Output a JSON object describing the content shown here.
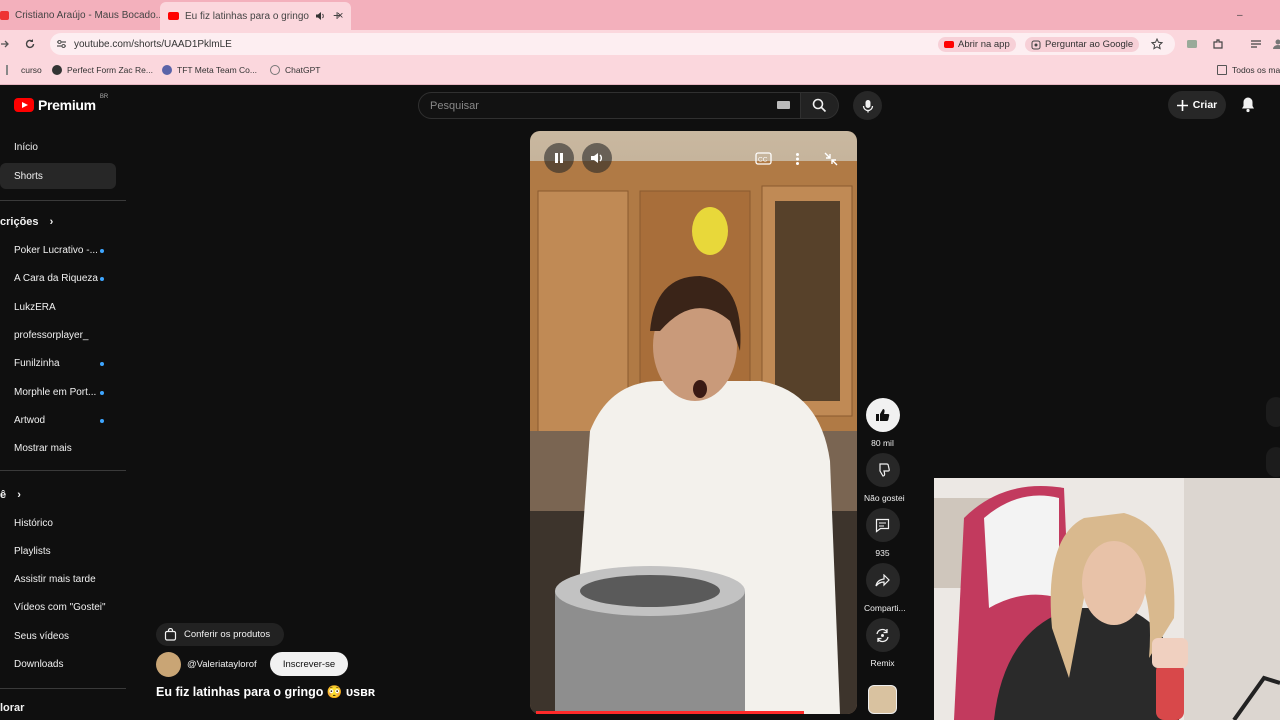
{
  "browser": {
    "tabs": [
      {
        "title": "Cristiano Araújo - Maus Bocado...",
        "close": "×"
      },
      {
        "title": "Eu fiz latinhas para o gringo",
        "close": "×"
      }
    ],
    "new_tab": "+",
    "url": "youtube.com/shorts/UAAD1PklmLE",
    "open_app": "Abrir na app",
    "ask_google": "Perguntar ao Google",
    "bookmarks": [
      {
        "label": "curso"
      },
      {
        "label": "Perfect Form Zac Re..."
      },
      {
        "label": "TFT Meta Team Co..."
      },
      {
        "label": "ChatGPT"
      }
    ],
    "all_bookmarks": "Todos os ma",
    "window_minimize": "–"
  },
  "yt": {
    "logo_text": "Premium",
    "logo_sup": "BR",
    "search_placeholder": "Pesquisar",
    "create_label": "Criar",
    "sidebar": {
      "top": [
        "Início",
        "Shorts"
      ],
      "subs_title": "crições",
      "subs": [
        {
          "label": "Poker Lucrativo -...",
          "dot": true
        },
        {
          "label": "A Cara da Riqueza",
          "dot": true
        },
        {
          "label": "LukzERA",
          "dot": false
        },
        {
          "label": "professorplayer_",
          "dot": false
        },
        {
          "label": "Funilzinha",
          "dot": true
        },
        {
          "label": "Morphle em Port...",
          "dot": true
        },
        {
          "label": "Artwod",
          "dot": true
        },
        {
          "label": "Mostrar mais",
          "dot": false
        }
      ],
      "you_title": "ê",
      "you": [
        "Histórico",
        "Playlists",
        "Assistir mais tarde",
        "Vídeos com \"Gostei\"",
        "Seus vídeos",
        "Downloads"
      ],
      "explore_title": "lorar"
    },
    "short": {
      "products_label": "Conferir os produtos",
      "channel_handle": "@Valeriataylorof",
      "subscribe_label": "Inscrever-se",
      "title": "Eu fiz latinhas para o gringo 😳 ᴜsʙʀ",
      "actions": {
        "likes": "80 mil",
        "dislike": "Não gostei",
        "comments": "935",
        "share": "Comparti...",
        "remix": "Remix"
      },
      "progress": 0.82
    }
  },
  "colors": {
    "chrome": "#f3b0bc",
    "yt_bg": "#0f0f0f",
    "brand_red": "#ff0000",
    "link_blue": "#3ea6ff"
  }
}
